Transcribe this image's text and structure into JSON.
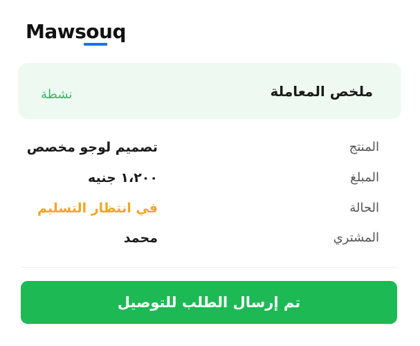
{
  "brand": {
    "name": "Mawsouq",
    "accent_color": "#1e6ff0"
  },
  "summary": {
    "title": "ملخص المعاملة",
    "status": "نشطة",
    "background_color": "#eefaf1",
    "status_color": "#3fb46a"
  },
  "details": {
    "product": {
      "label": "المنتج",
      "value": "تصميم لوجو مخصص"
    },
    "amount": {
      "label": "المبلغ",
      "value": "١،٢٠٠ جنيه"
    },
    "state": {
      "label": "الحالة",
      "value": "في انتظار التسليم",
      "color": "#f2a623"
    },
    "buyer": {
      "label": "المشتري",
      "value": "محمد"
    }
  },
  "action": {
    "label": "تم إرسال الطلب للتوصيل",
    "color": "#1db954"
  }
}
